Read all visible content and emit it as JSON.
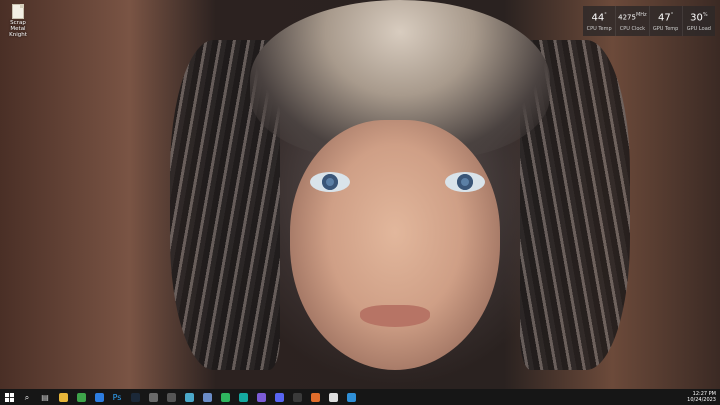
{
  "desktop": {
    "icons": [
      {
        "label": "Scrap Metal Knight",
        "icon": "document-icon"
      }
    ]
  },
  "hw_widget": {
    "cpu_temp": {
      "value": "44",
      "unit": "°",
      "label": "CPU Temp"
    },
    "cpu_clock": {
      "value": "4275",
      "unit": "MHz",
      "label": "CPU Clock"
    },
    "gpu_temp": {
      "value": "47",
      "unit": "°",
      "label": "GPU Temp"
    },
    "gpu_load": {
      "value": "30",
      "unit": "%",
      "label": "GPU Load"
    }
  },
  "taskbar": {
    "start_icon": "windows-logo-icon",
    "items": [
      {
        "name": "search",
        "glyph": "⌕",
        "color": "#ffffff"
      },
      {
        "name": "task-view",
        "glyph": "▤",
        "color": "#cccccc"
      },
      {
        "name": "file-explorer",
        "glyph": "",
        "color": "#e8b63a"
      },
      {
        "name": "chrome",
        "glyph": "",
        "color": "#3ea44a"
      },
      {
        "name": "app-blue",
        "glyph": "",
        "color": "#2d7de0"
      },
      {
        "name": "photoshop",
        "glyph": "Ps",
        "color": "#31a8ff"
      },
      {
        "name": "steam",
        "glyph": "",
        "color": "#1b2838"
      },
      {
        "name": "app-dark",
        "glyph": "",
        "color": "#6a6a6a"
      },
      {
        "name": "app-grey",
        "glyph": "",
        "color": "#555555"
      },
      {
        "name": "notepad",
        "glyph": "",
        "color": "#4ba8c9"
      },
      {
        "name": "photos",
        "glyph": "",
        "color": "#6a8cc7"
      },
      {
        "name": "app-green",
        "glyph": "",
        "color": "#2fb55f"
      },
      {
        "name": "app-teal",
        "glyph": "",
        "color": "#15a9a0"
      },
      {
        "name": "app-purple",
        "glyph": "",
        "color": "#7c5cd6"
      },
      {
        "name": "discord",
        "glyph": "",
        "color": "#5865f2"
      },
      {
        "name": "app-obs",
        "glyph": "",
        "color": "#3a3a3a"
      },
      {
        "name": "app-orange",
        "glyph": "",
        "color": "#e06d2b"
      },
      {
        "name": "app-white",
        "glyph": "",
        "color": "#dddddd"
      },
      {
        "name": "edge",
        "glyph": "",
        "color": "#2f8fd6"
      }
    ],
    "clock": {
      "time": "12:27 PM",
      "date": "10/24/2023"
    }
  }
}
